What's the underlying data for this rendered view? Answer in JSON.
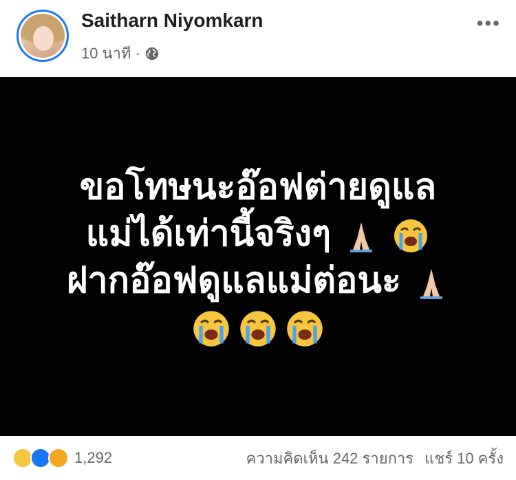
{
  "post": {
    "author": "Saitharn Niyomkarn",
    "time": "10 นาที ·",
    "privacy_icon": "globe-icon",
    "more_icon": "ellipsis-icon",
    "text_lines": [
      "ขอโทษนะอ๊อฟต่ายดูแล",
      "แม่ได้เท่านี้จริงๆ",
      "ฝากอ๊อฟดูแลแม่ต่อนะ"
    ],
    "emojis": [
      "praying-hands",
      "loudly-crying-face",
      "praying-hands",
      "loudly-crying-face",
      "loudly-crying-face",
      "loudly-crying-face"
    ]
  },
  "footer": {
    "reaction_icons": [
      "sad-reaction-icon",
      "like-reaction-icon",
      "care-reaction-icon"
    ],
    "reaction_count": "1,292",
    "comments": "ความคิดเห็น 242 รายการ",
    "shares": "แชร์ 10 ครั้ง"
  }
}
